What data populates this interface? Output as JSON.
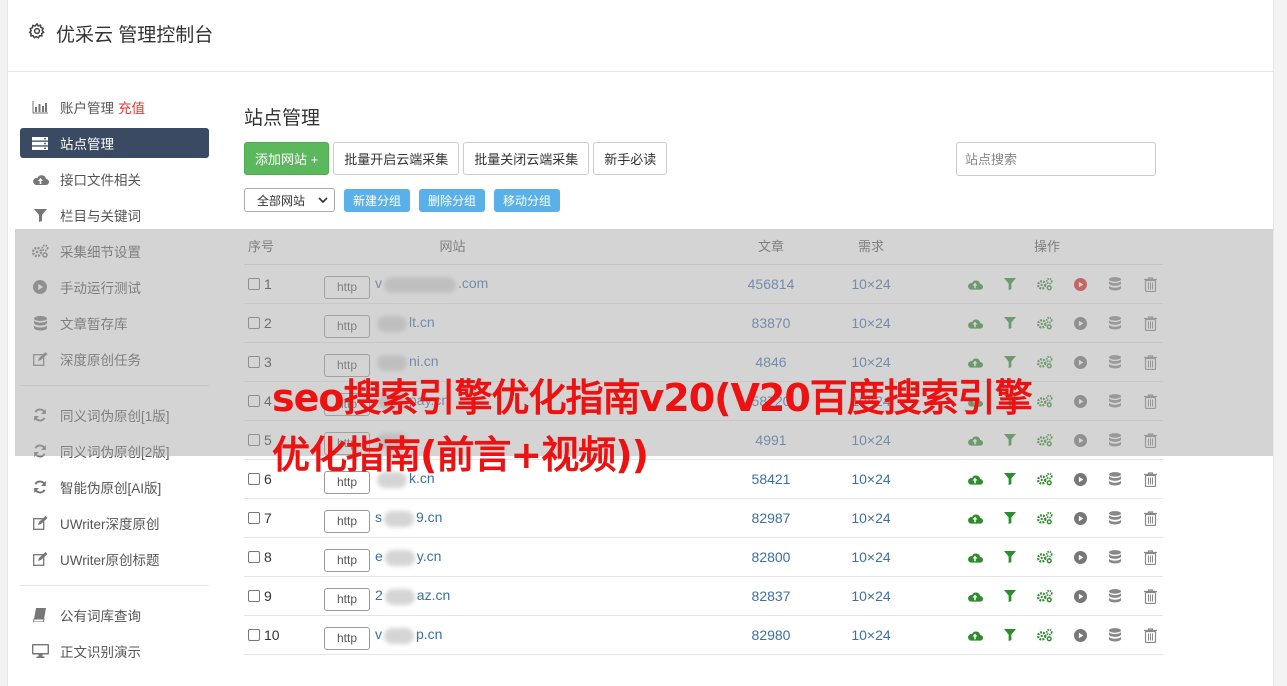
{
  "header": {
    "title": "优采云 管理控制台"
  },
  "sidebar": {
    "group1": [
      {
        "label": "账户管理",
        "badge": "充值",
        "icon": "bar-chart-icon"
      },
      {
        "label": "站点管理",
        "icon": "server-icon",
        "active": true
      },
      {
        "label": "接口文件相关",
        "icon": "cloud-upload-icon"
      },
      {
        "label": "栏目与关键词",
        "icon": "filter-icon"
      },
      {
        "label": "采集细节设置",
        "icon": "gears-icon"
      },
      {
        "label": "手动运行测试",
        "icon": "play-circle-icon"
      },
      {
        "label": "文章暂存库",
        "icon": "database-icon"
      },
      {
        "label": "深度原创任务",
        "icon": "edit-icon"
      }
    ],
    "group2": [
      {
        "label": "同义词伪原创[1版]",
        "icon": "refresh-icon"
      },
      {
        "label": "同义词伪原创[2版]",
        "icon": "refresh-icon"
      },
      {
        "label": "智能伪原创[AI版]",
        "icon": "refresh-icon"
      },
      {
        "label": "UWriter深度原创",
        "icon": "edit-icon"
      },
      {
        "label": "UWriter原创标题",
        "icon": "edit-icon"
      }
    ],
    "group3": [
      {
        "label": "公有词库查询",
        "icon": "book-icon"
      },
      {
        "label": "正文识别演示",
        "icon": "desktop-icon"
      }
    ]
  },
  "main": {
    "title": "站点管理",
    "buttons": {
      "add": "添加网站 +",
      "batch_open": "批量开启云端采集",
      "batch_close": "批量关闭云端采集",
      "guide": "新手必读"
    },
    "search_placeholder": "站点搜索",
    "group_select": "全部网站",
    "group_buttons": {
      "new": "新建分组",
      "delete": "删除分组",
      "move": "移动分组"
    },
    "table": {
      "headers": {
        "no": "序号",
        "site": "网站",
        "articles": "文章",
        "demand": "需求",
        "ops": "操作"
      },
      "rows": [
        {
          "no": "1",
          "prefix": "v",
          "suffix": ".com",
          "articles": "456814",
          "demand": "10×24",
          "running": true
        },
        {
          "no": "2",
          "prefix": "",
          "suffix": "lt.cn",
          "articles": "83870",
          "demand": "10×24"
        },
        {
          "no": "3",
          "prefix": "",
          "suffix": "ni.cn",
          "articles": "4846",
          "demand": "10×24"
        },
        {
          "no": "4",
          "prefix": "",
          "suffix": "pay.cn",
          "articles": "58720",
          "demand": "10×24"
        },
        {
          "no": "5",
          "prefix": "",
          "suffix": "",
          "articles": "4991",
          "demand": "10×24"
        },
        {
          "no": "6",
          "prefix": "",
          "suffix": "k.cn",
          "articles": "58421",
          "demand": "10×24"
        },
        {
          "no": "7",
          "prefix": "s",
          "suffix": "9.cn",
          "articles": "82987",
          "demand": "10×24"
        },
        {
          "no": "8",
          "prefix": "e",
          "suffix": "y.cn",
          "articles": "82800",
          "demand": "10×24"
        },
        {
          "no": "9",
          "prefix": "2",
          "suffix": "az.cn",
          "articles": "82837",
          "demand": "10×24"
        },
        {
          "no": "10",
          "prefix": "v",
          "suffix": "p.cn",
          "articles": "82980",
          "demand": "10×24"
        }
      ],
      "http_label": "http"
    }
  },
  "watermark": {
    "text": "seo搜索引擎优化指南v20(V20百度搜索引擎优化指南(前言+视频))"
  },
  "colors": {
    "accent_green": "#5cb85c",
    "sidebar_active": "#3a4a63",
    "link_blue": "#3a6fa8",
    "watermark_red": "#ee1111"
  }
}
